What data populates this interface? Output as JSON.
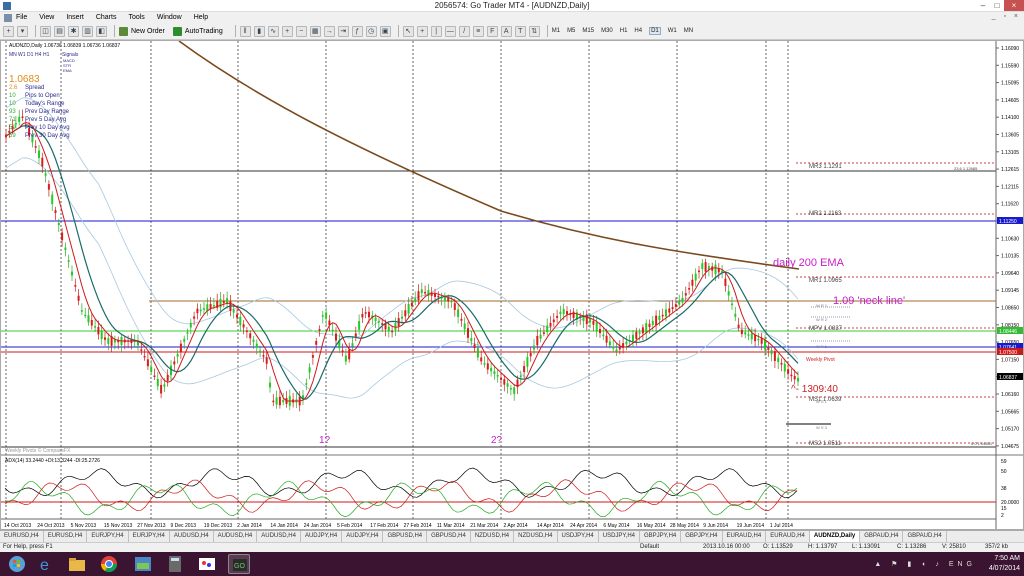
{
  "window": {
    "title": "2056574: Go Trader MT4 - [AUDNZD,Daily]",
    "minimize": "–",
    "maximize": "□",
    "close": "×"
  },
  "menu": [
    "File",
    "View",
    "Insert",
    "Charts",
    "Tools",
    "Window",
    "Help"
  ],
  "menu_controls": "_ ▫ ×",
  "toolbar": {
    "new_order": "New Order",
    "autotrading": "AutoTrading",
    "timeframes": [
      "M1",
      "M5",
      "M15",
      "M30",
      "H1",
      "H4",
      "D1",
      "W1",
      "MN"
    ],
    "active_timeframe": "D1"
  },
  "chart_header": "AUDNZD,Daily  1.06736 1.06839 1.06736 1.06837",
  "indicator_panel": {
    "labels": [
      "MN",
      "W1",
      "D1",
      "H4",
      "H1",
      "Signals"
    ],
    "mini_rows": [
      "MACD",
      "STR",
      "EMA"
    ],
    "price": "1.0683",
    "rows": [
      {
        "num": "2.6",
        "label": "Spread"
      },
      {
        "num": "10",
        "label": "Pips to Open"
      },
      {
        "num": "10",
        "label": "Today's Range"
      },
      {
        "num": "93",
        "label": "Prev Day Range"
      },
      {
        "num": "71",
        "label": "Prev 5 Day Avg"
      },
      {
        "num": "59",
        "label": "Prev 10 Day Avg"
      },
      {
        "num": "59",
        "label": "Prev 30 Day Avg"
      }
    ]
  },
  "watermark": "Weekly Pivots © CompassFX",
  "annotations": {
    "ema": "daily 200 EMA",
    "neck": "1.09 'neck line'",
    "q1": "1?",
    "q2": "2?",
    "timer": "^- 1309:40",
    "weekly_pivot": "Weekly Pivot"
  },
  "levels": {
    "mr3": "MR3  1.1291",
    "mr2": "MR2  1.1163",
    "mr1": "MR1  1.0965",
    "mpv": "MPV  1.0837",
    "ms1": "MS1  1.0639",
    "ms2": "MS2  1.0511",
    "fib_236": "23.6  1.12685",
    "fib_00": "0.0  1.04851",
    "wr1": "W R 1",
    "wr2": "W R 2",
    "wp": "W P 1",
    "ws1": "W S 1",
    "ws3": "W S 3"
  },
  "price_axis": [
    "1.16090",
    "1.15590",
    "1.15095",
    "1.14605",
    "1.14100",
    "1.13605",
    "1.13105",
    "1.12615",
    "1.12115",
    "1.11620",
    "1.11125",
    "1.10630",
    "1.10135",
    "1.09640",
    "1.09145",
    "1.08650",
    "1.08150",
    "1.07650",
    "1.07150",
    "1.06655",
    "1.06160",
    "1.05665",
    "1.05170",
    "1.04675"
  ],
  "price_axis_tags": [
    {
      "value": "1.11250",
      "color": "#1a1acc"
    },
    {
      "value": "1.08446",
      "color": "#33bb33"
    },
    {
      "value": "1.07641",
      "color": "#1a1acc"
    },
    {
      "value": "1.07500",
      "color": "#cc1a1a"
    },
    {
      "value": "1.06837",
      "color": "#000000"
    }
  ],
  "date_axis": [
    "14 Oct 2013",
    "24 Oct 2013",
    "5 Nov 2013",
    "15 Nov 2013",
    "27 Nov 2013",
    "9 Dec 2013",
    "19 Dec 2013",
    "2 Jan 2014",
    "14 Jan 2014",
    "24 Jan 2014",
    "5 Feb 2014",
    "17 Feb 2014",
    "27 Feb 2014",
    "11 Mar 2014",
    "21 Mar 2014",
    "2 Apr 2014",
    "14 Apr 2014",
    "24 Apr 2014",
    "6 May 2014",
    "16 May 2014",
    "28 May 2014",
    "9 Jun 2014",
    "19 Jun 2014",
    "1 Jul 2014"
  ],
  "adx": {
    "label": "ADX(14) 33.2440 +DI:13.3244 -DI:25.2726",
    "axis": [
      "59",
      "50",
      "38",
      "20.0000",
      "15",
      "2"
    ]
  },
  "tabs": [
    "EURUSD,H4",
    "EURUSD,H4",
    "EURJPY,H4",
    "EURJPY,H4",
    "AUDUSD,H4",
    "AUDUSD,H4",
    "AUDUSD,H4",
    "AUDJPY,H4",
    "AUDJPY,H4",
    "GBPUSD,H4",
    "GBPUSD,H4",
    "NZDUSD,H4",
    "NZDUSD,H4",
    "USDJPY,H4",
    "USDJPY,H4",
    "GBPJPY,H4",
    "GBPJPY,H4",
    "EURAUD,H4",
    "EURAUD,H4",
    "AUDNZD,Daily",
    "GBPAUD,H4",
    "GBPAUD,H4"
  ],
  "active_tab": "AUDNZD,Daily",
  "status": {
    "help": "For Help, press F1",
    "profile": "Default",
    "datetime": "2013.10.16 00:00",
    "open": "O: 1.13529",
    "high": "H: 1.13797",
    "low": "L: 1.13091",
    "close": "C: 1.13286",
    "volume": "V: 25810",
    "traffic": "357/2 kb"
  },
  "taskbar": {
    "time": "7:50 AM",
    "date": "4/07/2014",
    "lang": "ENG"
  }
}
